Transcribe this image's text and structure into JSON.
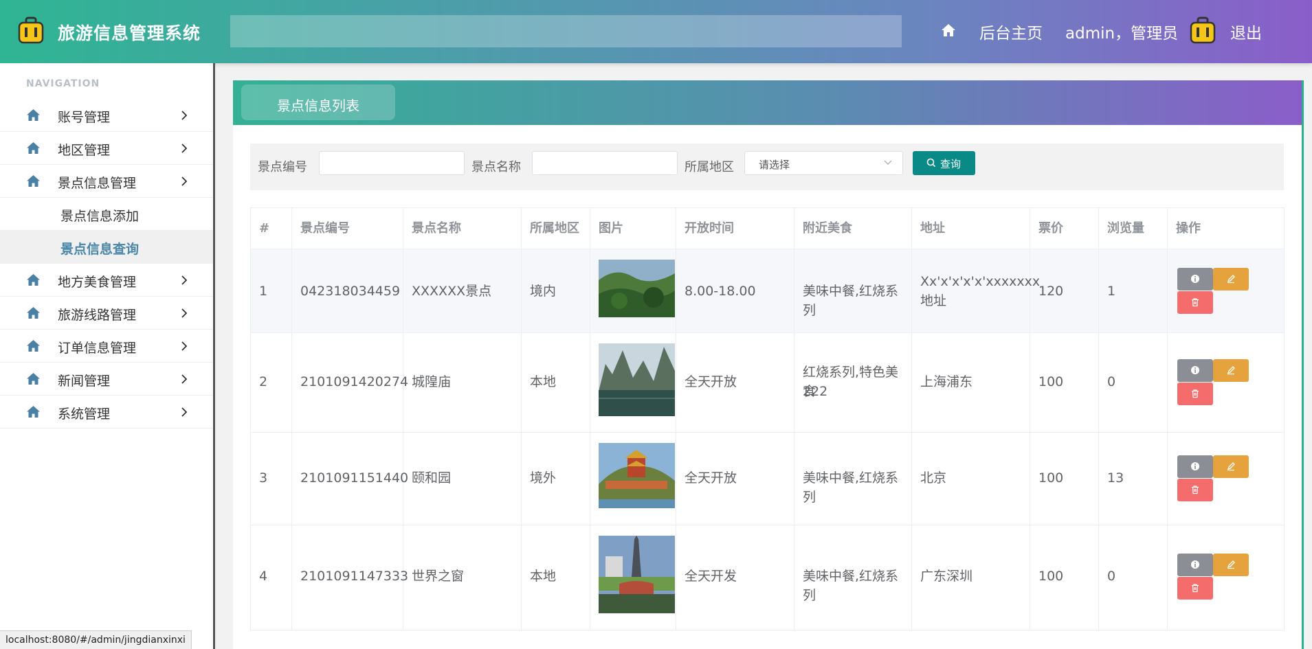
{
  "header": {
    "app_title": "旅游信息管理系统",
    "nav_home": "后台主页",
    "user": "admin，管理员",
    "logout": "退出"
  },
  "sidebar": {
    "nav_title": "NAVIGATION",
    "items": [
      {
        "label": "账号管理"
      },
      {
        "label": "地区管理"
      },
      {
        "label": "景点信息管理"
      },
      {
        "label": "地方美食管理"
      },
      {
        "label": "旅游线路管理"
      },
      {
        "label": "订单信息管理"
      },
      {
        "label": "新闻管理"
      },
      {
        "label": "系统管理"
      }
    ],
    "sub_items": [
      {
        "label": "景点信息添加"
      },
      {
        "label": "景点信息查询"
      }
    ]
  },
  "panel": {
    "tab": "景点信息列表"
  },
  "search": {
    "label_code": "景点编号",
    "label_name": "景点名称",
    "label_region": "所属地区",
    "select_placeholder": "请选择",
    "query_button": "查询"
  },
  "table": {
    "headers": [
      "#",
      "景点编号",
      "景点名称",
      "所属地区",
      "图片",
      "开放时间",
      "附近美食",
      "地址",
      "票价",
      "浏览量",
      "操作"
    ],
    "rows": [
      {
        "idx": "1",
        "code": "042318034459",
        "name": "XXXXXX景点",
        "region": "境内",
        "hours": "8.00-18.00",
        "food": "美味中餐,红烧系列",
        "addr1": "Xx'x'x'x'x'xxxxxxx",
        "addr2": "地址",
        "price": "120",
        "views": "1"
      },
      {
        "idx": "2",
        "code": "2101091420274",
        "name": "城隍庙",
        "region": "本地",
        "hours": "全天开放",
        "food1": "红烧系列,特色美食",
        "food2": "222",
        "addr": "上海浦东",
        "price": "100",
        "views": "0"
      },
      {
        "idx": "3",
        "code": "2101091151440",
        "name": "颐和园",
        "region": "境外",
        "hours": "全天开放",
        "food": "美味中餐,红烧系列",
        "addr": "北京",
        "price": "100",
        "views": "13"
      },
      {
        "idx": "4",
        "code": "2101091147333",
        "name": "世界之窗",
        "region": "本地",
        "hours": "全天开发",
        "food": "美味中餐,红烧系列",
        "addr": "广东深圳",
        "price": "100",
        "views": "0"
      }
    ]
  },
  "status_url": "localhost:8080/#/admin/jingdianxinxi",
  "colors": {
    "header_start": "#2fb593",
    "header_end": "#8a5ec9",
    "query_button": "#0a8a86",
    "info_button": "#8b8e95",
    "edit_button": "#e6a23c",
    "delete_button": "#f56c6c",
    "active_sub_item": "#4a86a8"
  }
}
